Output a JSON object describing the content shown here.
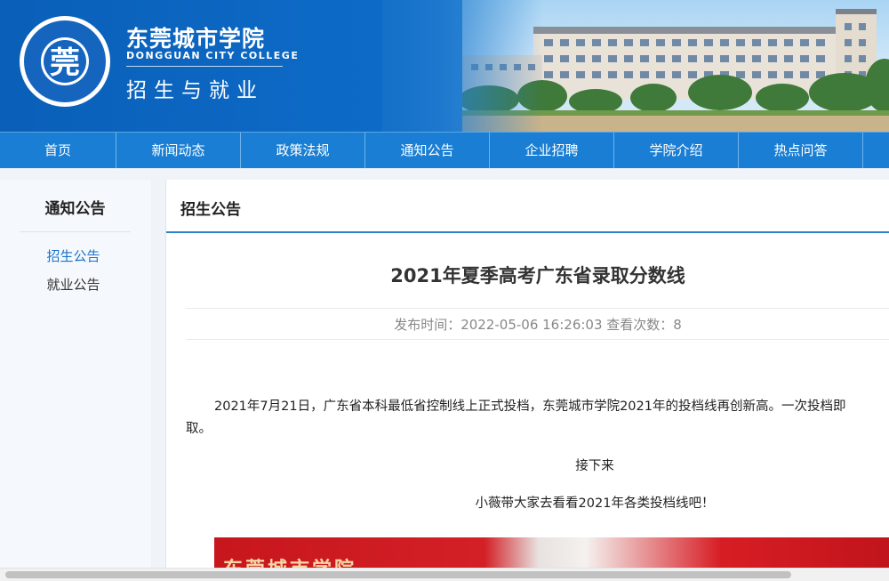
{
  "header": {
    "school_name_cn": "东莞城市学院",
    "school_name_en": "DONGGUAN CITY COLLEGE",
    "site_title": "招生与就业",
    "logo_ring_text": "东莞城市学院",
    "logo_ring_text_en": "DONGGUAN CITY COLLEGE"
  },
  "nav": {
    "items": [
      "首页",
      "新闻动态",
      "政策法规",
      "通知公告",
      "企业招聘",
      "学院介绍",
      "热点问答"
    ]
  },
  "sidebar": {
    "title": "通知公告",
    "items": [
      {
        "label": "招生公告",
        "active": true
      },
      {
        "label": "就业公告",
        "active": false
      }
    ]
  },
  "main": {
    "section_title": "招生公告",
    "article": {
      "title": "2021年夏季高考广东省录取分数线",
      "meta": "发布时间：2022-05-06 16:26:03 查看次数：8",
      "paragraph_line1": "2021年7月21日，广东省本科最低省控制线上正式投档，东莞城市学院2021年的投档线再创新高。一次投档即",
      "paragraph_line2": "取。",
      "line_next": "接下来",
      "line_intro": "小薇带大家去看看2021年各类投档线吧！",
      "poster_text": "东莞城市学院"
    }
  },
  "colors": {
    "nav_bg": "#1a7fd4",
    "accent": "#2f7fc9",
    "active_link": "#1a73c9"
  }
}
